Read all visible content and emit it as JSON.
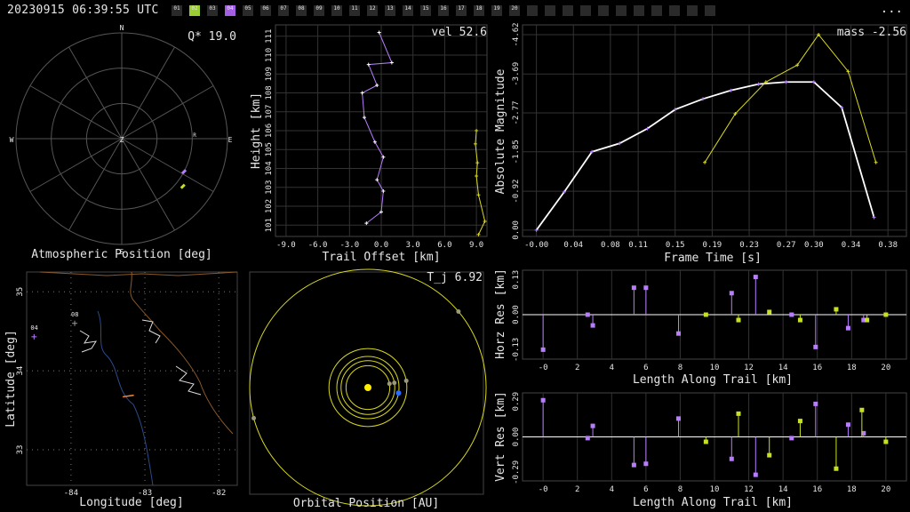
{
  "header": {
    "timestamp": "20230915 06:39:55 UTC",
    "menu": "...",
    "stations": [
      "01",
      "02",
      "03",
      "04",
      "05",
      "06",
      "07",
      "08",
      "09",
      "10",
      "11",
      "12",
      "13",
      "14",
      "15",
      "16",
      "17",
      "18",
      "19",
      "20",
      "",
      "",
      "",
      "",
      "",
      "",
      "",
      "",
      "",
      "",
      ""
    ],
    "station_colors": {
      "02": "#9acd32",
      "04": "#a45ee5"
    }
  },
  "colors": {
    "purple": "#b87cff",
    "green": "#c8e022",
    "white": "#ffffff",
    "yellow": "#d8d820",
    "grid": "#333333"
  },
  "chart_data": [
    {
      "type": "scatter",
      "name_id": "atmospheric",
      "xlabel": "Atmospheric Position [deg]",
      "title": "",
      "annotation": "Q* 19.0",
      "compass": [
        "N",
        "E",
        "S",
        "W",
        "Z"
      ],
      "radiant_label": "R",
      "points": [
        {
          "az": 118,
          "alt": 30,
          "series": "04"
        },
        {
          "az": 128,
          "alt": 24,
          "series": "02"
        }
      ]
    },
    {
      "type": "line",
      "name_id": "trail",
      "title": "",
      "annotation": "vel 52.6",
      "xlabel": "Trail Offset [km]",
      "ylabel": "Height [km]",
      "xlim": [
        -10,
        10
      ],
      "ylim": [
        100.4,
        111.6
      ],
      "xticks": [
        "-9.0",
        "-6.0",
        "-3.0",
        "0.0",
        "3.0",
        "6.0",
        "9.0"
      ],
      "xtick_values": [
        -9,
        -6,
        -3,
        0,
        3,
        6,
        9
      ],
      "yticks": [
        "101",
        "102",
        "103",
        "104",
        "105",
        "106",
        "107",
        "108",
        "109",
        "110",
        "111"
      ],
      "ytick_values": [
        101,
        102,
        103,
        104,
        105,
        106,
        107,
        108,
        109,
        110,
        111
      ],
      "series": [
        {
          "name": "04",
          "x": [
            -0.2,
            1.0,
            -1.2,
            -0.4,
            -1.8,
            -1.6,
            -0.6,
            0.2,
            -0.4,
            0.2,
            0.0,
            -1.4
          ],
          "y": [
            111.2,
            109.6,
            109.5,
            108.4,
            108.0,
            106.7,
            105.4,
            104.6,
            103.4,
            102.8,
            101.7,
            101.1
          ]
        },
        {
          "name": "02",
          "x": [
            9.0,
            8.9,
            9.1,
            9.0,
            9.2,
            9.8,
            9.2
          ],
          "y": [
            106.0,
            105.3,
            104.3,
            103.6,
            102.6,
            101.2,
            100.5
          ]
        }
      ]
    },
    {
      "type": "line",
      "name_id": "magnitude",
      "title": "",
      "annotation": "mass -2.56",
      "xlabel": "Frame Time [s]",
      "ylabel": "Absolute Magnitude",
      "xlim": [
        -0.015,
        0.4
      ],
      "ylim": [
        0.15,
        -4.85
      ],
      "xticks": [
        "-0.00",
        "0.04",
        "0.08",
        "0.11",
        "0.15",
        "0.19",
        "0.23",
        "0.27",
        "0.30",
        "0.34",
        "0.38"
      ],
      "xtick_values": [
        0.0,
        0.04,
        0.08,
        0.11,
        0.15,
        0.19,
        0.23,
        0.27,
        0.3,
        0.34,
        0.38
      ],
      "yticks": [
        "0.00",
        "-0.92",
        "-1.85",
        "-2.77",
        "-3.69",
        "-4.62"
      ],
      "ytick_values": [
        0.0,
        -0.92,
        -1.85,
        -2.77,
        -3.69,
        -4.62
      ],
      "series": [
        {
          "name": "04",
          "x": [
            0.0,
            0.03,
            0.06,
            0.09,
            0.12,
            0.15,
            0.18,
            0.21,
            0.24,
            0.27,
            0.3,
            0.33,
            0.365
          ],
          "y": [
            0.0,
            -0.9,
            -1.85,
            -2.05,
            -2.4,
            -2.85,
            -3.1,
            -3.3,
            -3.45,
            -3.5,
            -3.5,
            -2.9,
            -0.3
          ]
        },
        {
          "name": "02",
          "x": [
            0.182,
            0.215,
            0.248,
            0.282,
            0.305,
            0.337,
            0.367
          ],
          "y": [
            -1.6,
            -2.75,
            -3.5,
            -3.9,
            -4.62,
            -3.75,
            -1.6
          ]
        }
      ]
    },
    {
      "type": "scatter",
      "name_id": "map",
      "title": "",
      "xlabel": "Longitude [deg]",
      "ylabel": "Latitude [deg]",
      "xlim": [
        -84.6,
        -81.75
      ],
      "ylim": [
        32.55,
        35.25
      ],
      "xticks": [
        "-84",
        "-83",
        "-82"
      ],
      "xtick_values": [
        -84,
        -83,
        -82
      ],
      "yticks": [
        "33",
        "34",
        "35"
      ],
      "ytick_values": [
        33,
        34,
        35
      ],
      "stations": [
        {
          "label": "04",
          "lon": -84.5,
          "lat": 34.43
        },
        {
          "label": "08",
          "lon": -83.95,
          "lat": 34.6
        }
      ],
      "track": {
        "lon1": -83.3,
        "lat1": 33.67,
        "lon2": -83.15,
        "lat2": 33.69
      }
    },
    {
      "type": "scatter",
      "name_id": "orbit",
      "title": "",
      "annotation": "T_j 6.92",
      "xlabel": "Orbital Position [AU]",
      "orbit_radii_au": [
        0.39,
        0.72,
        1.0,
        1.52,
        5.2
      ],
      "planets": [
        {
          "r": 0.39,
          "angle": 10
        },
        {
          "r": 0.72,
          "angle": 10
        },
        {
          "r": 1.0,
          "angle": -10
        },
        {
          "r": 1.52,
          "angle": 10
        },
        {
          "r": 5.2,
          "angle": 40
        },
        {
          "r": 5.2,
          "angle": 195
        }
      ]
    },
    {
      "type": "bar",
      "name_id": "horz-res",
      "title": "",
      "xlabel": "Length Along Trail [km]",
      "ylabel": "Horz Res [km]",
      "xlim": [
        -1.2,
        21.2
      ],
      "ylim": [
        -0.165,
        0.165
      ],
      "xticks": [
        "-0",
        "2",
        "4",
        "6",
        "8",
        "10",
        "12",
        "14",
        "16",
        "18",
        "20"
      ],
      "xtick_values": [
        0,
        2,
        4,
        6,
        8,
        10,
        12,
        14,
        16,
        18,
        20
      ],
      "yticks": [
        "-0.13",
        "0.00",
        "0.13"
      ],
      "ytick_values": [
        -0.13,
        0,
        0.13
      ],
      "series": [
        {
          "name": "04",
          "x": [
            0.0,
            2.6,
            2.9,
            5.3,
            6.0,
            7.9,
            11.0,
            12.4,
            14.5,
            15.9,
            17.8,
            18.7
          ],
          "y": [
            -0.13,
            0.0,
            -0.04,
            0.1,
            0.1,
            -0.07,
            0.08,
            0.14,
            0.0,
            -0.12,
            -0.05,
            -0.02
          ]
        },
        {
          "name": "02",
          "x": [
            9.5,
            11.4,
            13.2,
            15.0,
            17.1,
            18.9,
            20.0
          ],
          "y": [
            0.0,
            -0.02,
            0.01,
            -0.02,
            0.02,
            -0.02,
            0.0
          ]
        }
      ]
    },
    {
      "type": "bar",
      "name_id": "vert-res",
      "title": "",
      "xlabel": "Length Along Trail [km]",
      "ylabel": "Vert Res [km]",
      "xlim": [
        -1.2,
        21.2
      ],
      "ylim": [
        -0.36,
        0.36
      ],
      "xticks": [
        "-0",
        "2",
        "4",
        "6",
        "8",
        "10",
        "12",
        "14",
        "16",
        "18",
        "20"
      ],
      "xtick_values": [
        0,
        2,
        4,
        6,
        8,
        10,
        12,
        14,
        16,
        18,
        20
      ],
      "yticks": [
        "-0.29",
        "0.00",
        "0.29"
      ],
      "ytick_values": [
        -0.29,
        0,
        0.29
      ],
      "series": [
        {
          "name": "04",
          "x": [
            0.0,
            2.6,
            2.9,
            5.3,
            6.0,
            7.9,
            11.0,
            12.4,
            14.5,
            15.9,
            17.8,
            18.7
          ],
          "y": [
            0.3,
            -0.01,
            0.09,
            -0.23,
            -0.22,
            0.15,
            -0.18,
            -0.31,
            -0.01,
            0.27,
            0.1,
            0.03
          ]
        },
        {
          "name": "02",
          "x": [
            9.5,
            11.4,
            13.2,
            15.0,
            17.1,
            18.6,
            20.0
          ],
          "y": [
            -0.04,
            0.19,
            -0.15,
            0.13,
            -0.26,
            0.22,
            -0.04
          ]
        }
      ]
    }
  ]
}
